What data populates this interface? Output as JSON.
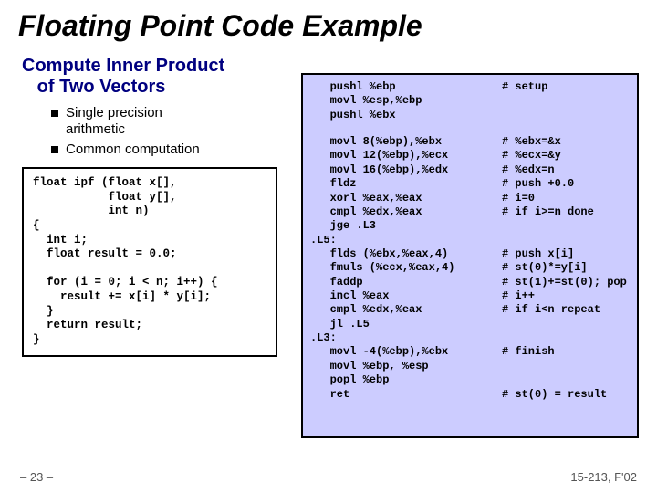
{
  "title": "Floating Point Code Example",
  "subtitle_l1": "Compute Inner Product",
  "subtitle_l2": "of Two Vectors",
  "bullets": {
    "b1a": "Single precision",
    "b1b": "arithmetic",
    "b2": "Common computation"
  },
  "c_code": "float ipf (float x[],\n           float y[],\n           int n)\n{\n  int i;\n  float result = 0.0;\n\n  for (i = 0; i < n; i++) {\n    result += x[i] * y[i];\n  }\n  return result;\n}",
  "asm": [
    {
      "i": "   pushl %ebp",
      "c": "# setup"
    },
    {
      "i": "   movl %esp,%ebp",
      "c": ""
    },
    {
      "i": "   pushl %ebx",
      "c": ""
    },
    {
      "blank": true
    },
    {
      "i": "   movl 8(%ebp),%ebx",
      "c": "# %ebx=&x"
    },
    {
      "i": "   movl 12(%ebp),%ecx",
      "c": "# %ecx=&y"
    },
    {
      "i": "   movl 16(%ebp),%edx",
      "c": "# %edx=n"
    },
    {
      "i": "   fldz",
      "c": "# push +0.0"
    },
    {
      "i": "   xorl %eax,%eax",
      "c": "# i=0"
    },
    {
      "i": "   cmpl %edx,%eax",
      "c": "# if i>=n done"
    },
    {
      "i": "   jge .L3",
      "c": ""
    },
    {
      "i": ".L5:",
      "c": ""
    },
    {
      "i": "   flds (%ebx,%eax,4)",
      "c": "# push x[i]"
    },
    {
      "i": "   fmuls (%ecx,%eax,4)",
      "c": "# st(0)*=y[i]"
    },
    {
      "i": "   faddp",
      "c": "# st(1)+=st(0); pop"
    },
    {
      "i": "   incl %eax",
      "c": "# i++"
    },
    {
      "i": "   cmpl %edx,%eax",
      "c": "# if i<n repeat"
    },
    {
      "i": "   jl .L5",
      "c": ""
    },
    {
      "i": ".L3:",
      "c": ""
    },
    {
      "i": "   movl -4(%ebp),%ebx",
      "c": "# finish"
    },
    {
      "i": "   movl %ebp, %esp",
      "c": ""
    },
    {
      "i": "   popl %ebp",
      "c": ""
    },
    {
      "i": "   ret",
      "c": "# st(0) = result"
    }
  ],
  "footer": {
    "left": "– 23 –",
    "right": "15-213, F'02"
  }
}
